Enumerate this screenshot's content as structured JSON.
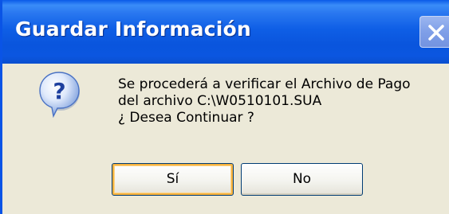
{
  "dialog": {
    "title": "Guardar Información",
    "icon": "question-icon",
    "message_lines": [
      "Se procederá a verificar el Archivo de Pago",
      "del archivo C:\\W0510101.SUA",
      "¿ Desea Continuar ?"
    ],
    "buttons": {
      "yes_label": "Sí",
      "no_label": "No"
    },
    "close_icon": "close-icon"
  },
  "colors": {
    "titlebar": "#0a55dd",
    "face": "#ece9d8",
    "focus_ring": "#f8b33e"
  }
}
